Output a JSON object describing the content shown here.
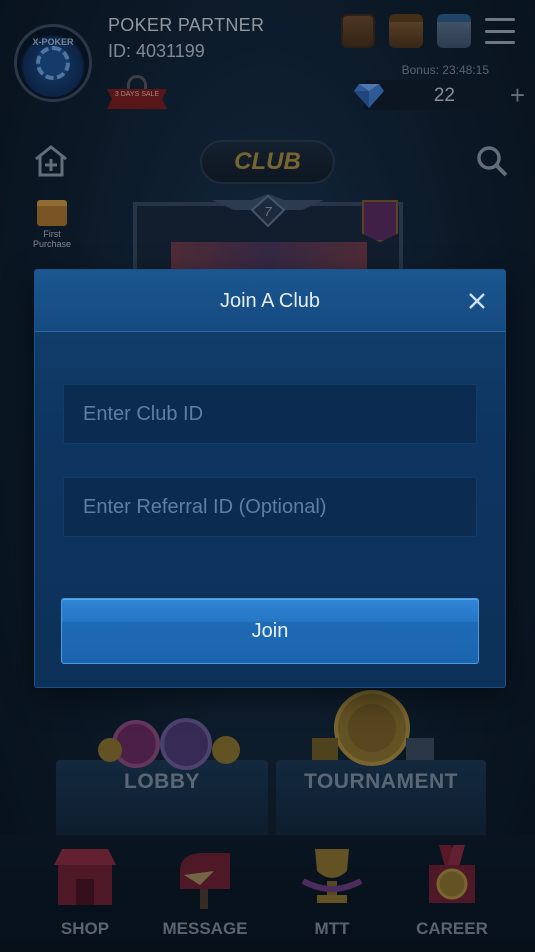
{
  "header": {
    "username": "POKER PARTNER",
    "user_id": "ID: 4031199",
    "avatar_brand": "X-POKER",
    "sale_badge": "3 DAYS SALE",
    "bonus_label": "Bonus: 23:48:15",
    "gem_count": "22",
    "gem_add": "+"
  },
  "club_page": {
    "title": "CLUB",
    "first_purchase": "First Purchase",
    "level": "7"
  },
  "panels": {
    "lobby": "LOBBY",
    "tournament": "TOURNAMENT"
  },
  "bottom_nav": [
    {
      "label": "SHOP"
    },
    {
      "label": "MESSAGE"
    },
    {
      "label": "MTT"
    },
    {
      "label": "CAREER"
    }
  ],
  "dialog": {
    "title": "Join A Club",
    "club_id_placeholder": "Enter Club ID",
    "referral_placeholder": "Enter Referral ID (Optional)",
    "join_label": "Join"
  },
  "colors": {
    "dialog_bg": "#0e3561",
    "join_button": "#2677c6",
    "field_bg": "#0b2c50"
  },
  "icons": [
    "avatar",
    "backpack-icon",
    "treasure-chest-icon",
    "calendar-icon",
    "menu-icon",
    "diamond-icon",
    "home-add-icon",
    "search-icon",
    "gift-icon",
    "close-icon"
  ]
}
